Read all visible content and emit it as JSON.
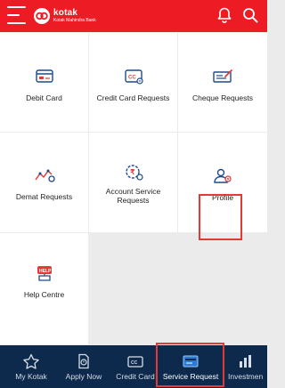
{
  "header": {
    "logo_name": "kotak",
    "logo_subtitle": "Kotak Mahindra Bank",
    "icons": [
      "menu-icon",
      "bell-icon",
      "search-icon"
    ],
    "brand_color": "#ed1c24"
  },
  "tiles": [
    {
      "label": "Debit Card",
      "icon": "debit-card-icon"
    },
    {
      "label": "Credit Card Requests",
      "icon": "credit-card-icon"
    },
    {
      "label": "Cheque Requests",
      "icon": "cheque-icon"
    },
    {
      "label": "Demat Requests",
      "icon": "demat-chart-icon"
    },
    {
      "label": "Account Service\nRequests",
      "icon": "account-service-icon"
    },
    {
      "label": "Profile",
      "icon": "profile-icon"
    },
    {
      "label": "Help Centre",
      "icon": "help-icon"
    }
  ],
  "bottom_nav": {
    "items": [
      {
        "label": "My Kotak",
        "icon": "star-icon"
      },
      {
        "label": "Apply Now",
        "icon": "apply-document-icon"
      },
      {
        "label": "Credit Card",
        "icon": "credit-card-icon"
      },
      {
        "label": "Service Request",
        "icon": "service-request-icon",
        "active": true
      },
      {
        "label": "Investmen",
        "icon": "investment-chart-icon"
      }
    ],
    "background": "#0d2a4d"
  }
}
